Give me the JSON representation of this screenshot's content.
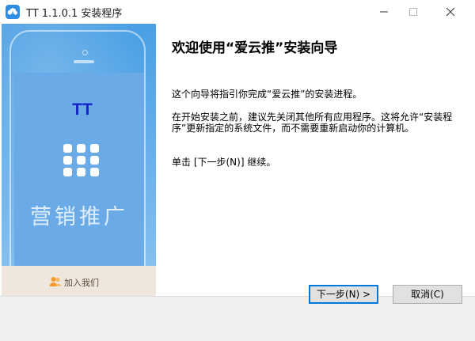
{
  "window": {
    "title": "TT 1.1.0.1 安装程序",
    "icon": "cloud-app-icon",
    "controls": [
      "minimize-icon",
      "maximize-icon",
      "close-icon"
    ]
  },
  "banner": {
    "brand": "TT",
    "promo": "营销推广",
    "join_label": "加入我们",
    "colors": {
      "blue": "#4a9fe3",
      "screen": "#6aabe7",
      "brand_text": "#1426c8",
      "join_bar": "#efe7dd"
    }
  },
  "content": {
    "heading": "欢迎使用“爱云推”安装向导",
    "p1": "这个向导将指引你完成“爱云推”的安装进程。",
    "p2": "在开始安装之前，建议先关闭其他所有应用程序。这将允许“安装程序”更新指定的系统文件，而不需要重新启动你的计算机。",
    "p3": "单击 [下一步(N)] 继续。"
  },
  "buttons": {
    "next": "下一步(N) >",
    "cancel": "取消(C)"
  }
}
